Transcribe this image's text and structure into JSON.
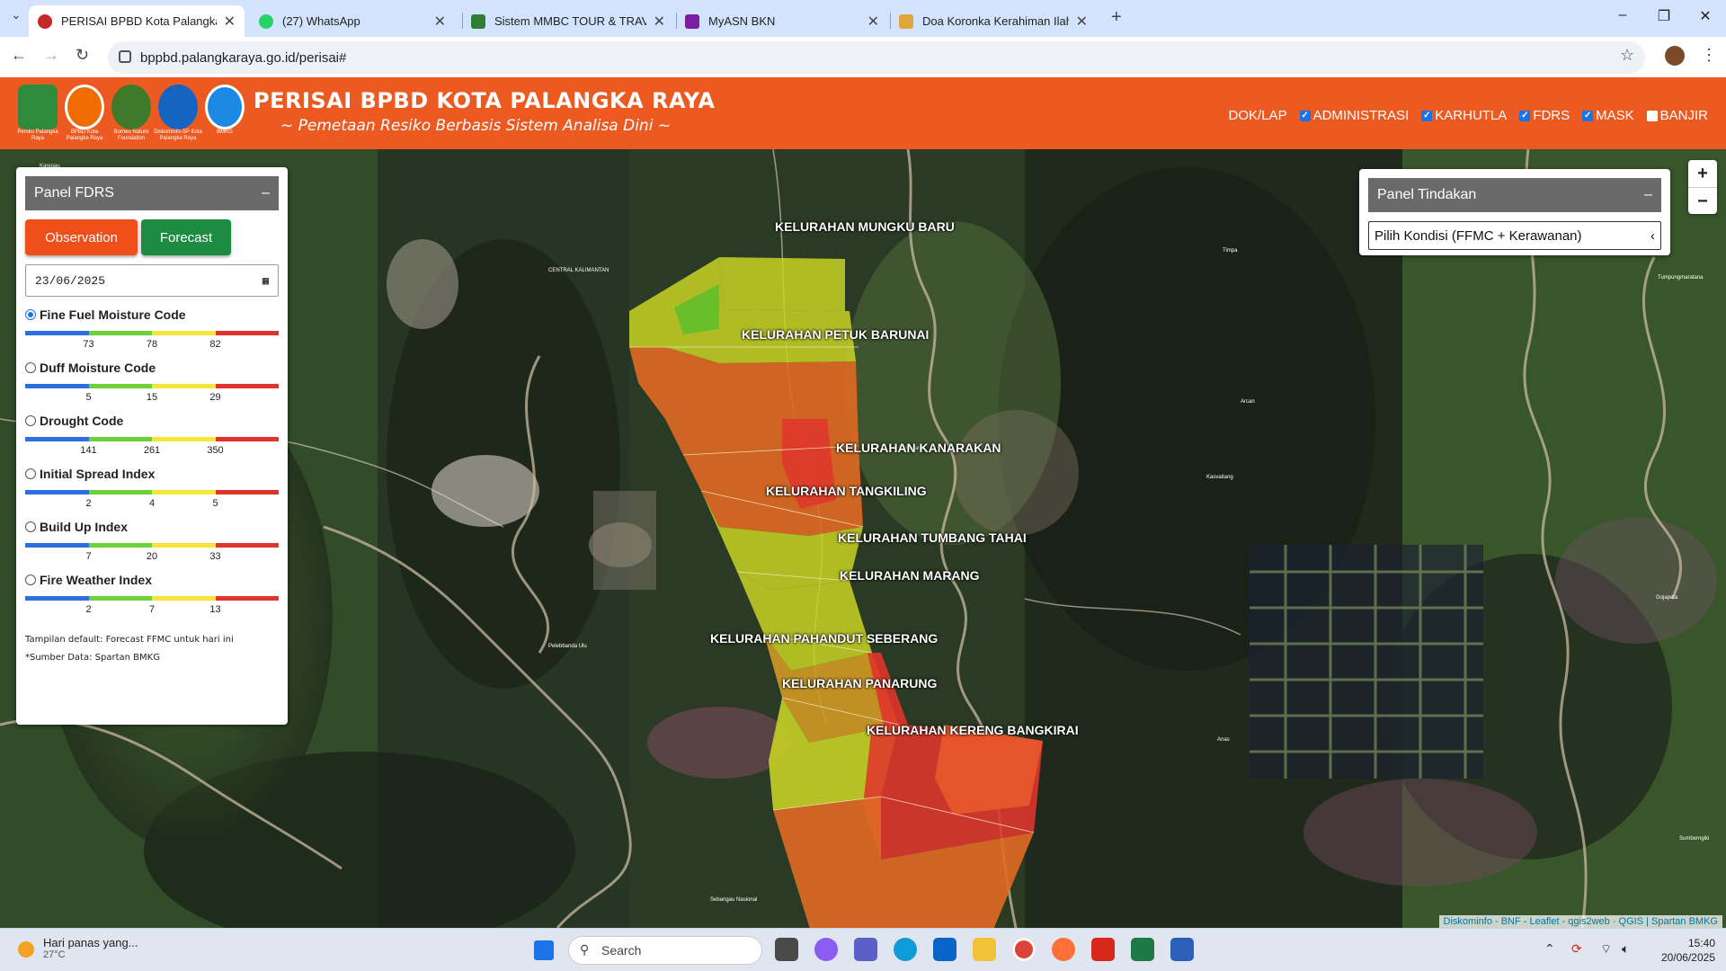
{
  "browser": {
    "tabs": [
      {
        "title": "PERISAI BPBD Kota Palangka Ra",
        "active": true,
        "icon": "bpbd-icon",
        "color": "#c62828"
      },
      {
        "title": "(27) WhatsApp",
        "active": false,
        "icon": "whatsapp-icon",
        "color": "#25d366"
      },
      {
        "title": "Sistem MMBC TOUR & TRAVEL",
        "active": false,
        "icon": "travel-icon",
        "color": "#2e7d32"
      },
      {
        "title": "MyASN BKN",
        "active": false,
        "icon": "bkn-icon",
        "color": "#7b1fa2"
      },
      {
        "title": "Doa Koronka Kerahiman Ilahi Y",
        "active": false,
        "icon": "document-icon",
        "color": "#e0a63a"
      }
    ],
    "url": "bppbd.palangkaraya.go.id/perisai#"
  },
  "header": {
    "title": "PERISAI BPBD KOTA PALANGKA RAYA",
    "subtitle": "~ Pemetaan Resiko Berbasis Sistem Analisa Dini ~",
    "logos": [
      {
        "caption": "Pemko Palangka Raya",
        "color": "#2e8b3c"
      },
      {
        "caption": "BPBD Kota Palangka Raya",
        "color": "#ef6c00"
      },
      {
        "caption": "Borneo Nature Foundation",
        "color": "#3f7a2a"
      },
      {
        "caption": "Diskominfo-SP Kota Palangka Raya",
        "color": "#1565c0"
      },
      {
        "caption": "BMKG",
        "color": "#1e88e5"
      }
    ],
    "nav": [
      {
        "label": "DOK/LAP",
        "checkbox": false
      },
      {
        "label": "ADMINISTRASI",
        "checkbox": true,
        "checked": true
      },
      {
        "label": "KARHUTLA",
        "checkbox": true,
        "checked": true
      },
      {
        "label": "FDRS",
        "checkbox": true,
        "checked": true
      },
      {
        "label": "MASK",
        "checkbox": true,
        "checked": true
      },
      {
        "label": "BANJIR",
        "checkbox": true,
        "checked": false
      }
    ]
  },
  "fdrs_panel": {
    "title": "Panel FDRS",
    "collapse": "–",
    "observation_label": "Observation",
    "forecast_label": "Forecast",
    "date": "23/06/2025",
    "scale_colors": [
      "#2e6fe0",
      "#6fd13a",
      "#f6e63a",
      "#e0352b"
    ],
    "indices": [
      {
        "label": "Fine Fuel Moisture Code",
        "selected": true,
        "ticks": [
          "73",
          "78",
          "82"
        ]
      },
      {
        "label": "Duff Moisture Code",
        "selected": false,
        "ticks": [
          "5",
          "15",
          "29"
        ]
      },
      {
        "label": "Drought Code",
        "selected": false,
        "ticks": [
          "141",
          "261",
          "350"
        ]
      },
      {
        "label": "Initial Spread Index",
        "selected": false,
        "ticks": [
          "2",
          "4",
          "5"
        ]
      },
      {
        "label": "Build Up Index",
        "selected": false,
        "ticks": [
          "7",
          "20",
          "33"
        ]
      },
      {
        "label": "Fire Weather Index",
        "selected": false,
        "ticks": [
          "2",
          "7",
          "13"
        ]
      }
    ],
    "note_default": "Tampilan default: Forecast FFMC untuk hari ini",
    "note_source": "*Sumber Data: Spartan BMKG"
  },
  "action_panel": {
    "title": "Panel Tindakan",
    "collapse": "–",
    "select_value": "Pilih Kondisi (FFMC + Kerawanan)"
  },
  "map": {
    "zoom_in": "+",
    "zoom_out": "−",
    "attribution": "Diskominfo - BNF - Leaflet - qgis2web · QGIS | Spartan BMKG",
    "kelurahan": [
      "KELURAHAN MUNGKU BARU",
      "KELURAHAN PETUK BARUNAI",
      "KELURAHAN KANARAKAN",
      "KELURAHAN TANGKILING",
      "KELURAHAN TUMBANG TAHAI",
      "KELURAHAN MARANG",
      "KELURAHAN PAHANDUT SEBERANG",
      "KELURAHAN PANARUNG",
      "KELURAHAN KERENG BANGKIRAI"
    ]
  },
  "taskbar": {
    "weather_text": "Hari panas yang...",
    "weather_temp": "27°C",
    "search_placeholder": "Search",
    "time": "15:40",
    "date": "20/06/2025"
  }
}
